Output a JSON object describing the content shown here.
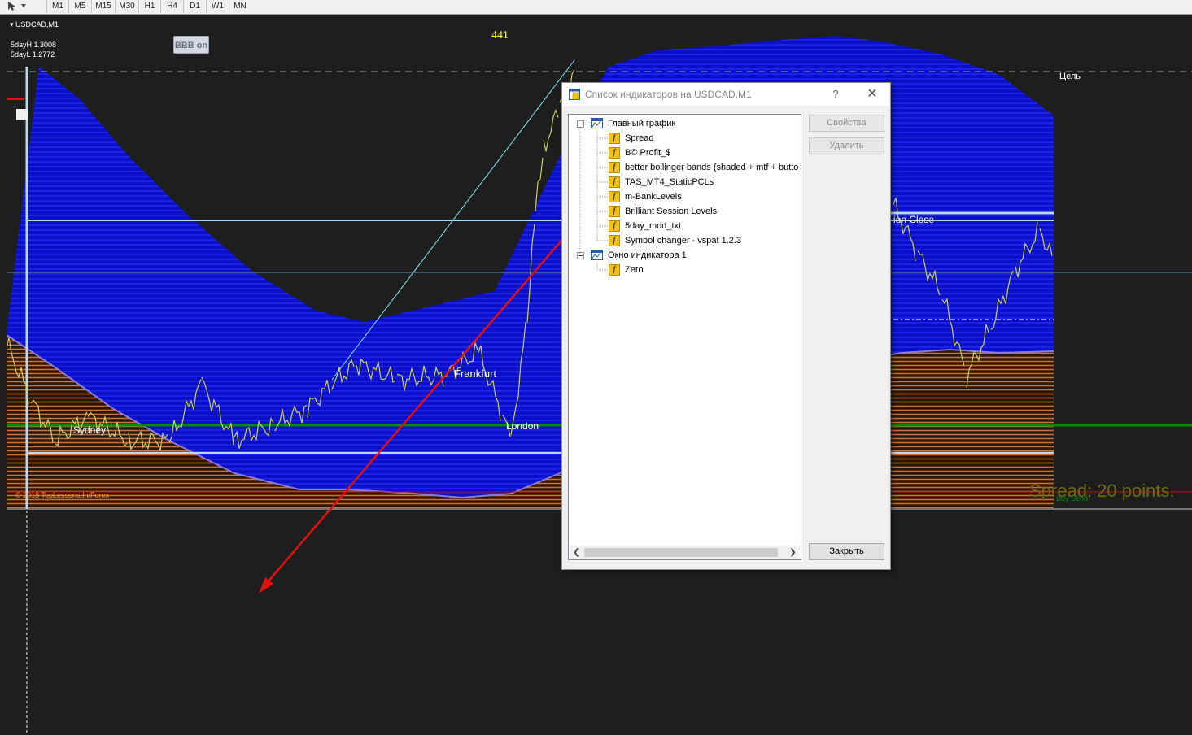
{
  "toolbar": {
    "tool_icon": "cursor-tools-icon",
    "timeframes": [
      "M1",
      "M5",
      "M15",
      "M30",
      "H1",
      "H4",
      "D1",
      "W1",
      "MN"
    ]
  },
  "chart": {
    "symbol": "USDCAD,M1",
    "day_high": "5dayH 1.3008",
    "day_low": "5dayL 1.2772",
    "counter": "441",
    "bbb_button": "BBB on",
    "target_label": "Цель",
    "session_labels": {
      "sydney": "Sydney",
      "frankfurt": "Frankfurt",
      "london": "London",
      "session_close": "ion Close"
    },
    "copyright": "© 2018 TopLessons.In/Forex",
    "spread": "Spread: 20 points.",
    "buy_label": "Buy Send"
  },
  "dialog": {
    "title": "Список индикаторов на USDCAD,M1",
    "help": "?",
    "close_glyph": "✕",
    "groups": [
      {
        "name": "Главный график",
        "items": [
          "Spread",
          "B© Profit_$",
          "better bollinger bands (shaded + mtf + butto",
          "TAS_MT4_StaticPCLs",
          "m-BankLevels",
          "Brilliant Session Levels",
          "5day_mod_txt",
          "Symbol changer - vspat 1.2.3"
        ]
      },
      {
        "name": "Окно индикатора 1",
        "items": [
          "Zero"
        ]
      }
    ],
    "buttons": {
      "properties": "Свойства",
      "delete": "Удалить",
      "close": "Закрыть"
    },
    "colors": {
      "accent": "#2a5aa8",
      "indicator_icon": "#f2c21b"
    }
  }
}
